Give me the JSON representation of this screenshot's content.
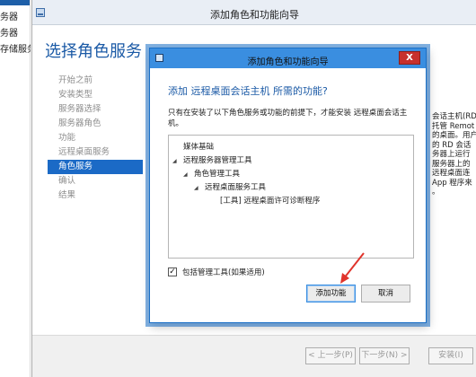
{
  "server_manager_sidebar": {
    "items": [
      "务器",
      "务器",
      "存储服务"
    ]
  },
  "outer_wizard": {
    "title": "添加角色和功能向导",
    "page_title": "选择角色服务",
    "nav": [
      {
        "label": "开始之前",
        "state": "normal"
      },
      {
        "label": "安装类型",
        "state": "normal"
      },
      {
        "label": "服务器选择",
        "state": "normal"
      },
      {
        "label": "服务器角色",
        "state": "normal"
      },
      {
        "label": "功能",
        "state": "normal"
      },
      {
        "label": "远程桌面服务",
        "state": "normal"
      },
      {
        "label": "角色服务",
        "state": "active"
      },
      {
        "label": "确认",
        "state": "normal"
      },
      {
        "label": "结果",
        "state": "normal"
      }
    ],
    "right_description_lines": [
      "会话主机(RD",
      "托管 Remot",
      "的桌面。用户",
      "的 RD 会话",
      "务器上运行",
      "服务器上的",
      "远程桌面连",
      "App 程序来",
      "。"
    ],
    "footer": {
      "prev_label": "< 上一步(P)",
      "next_label": "下一步(N) >",
      "install_label": "安装(I)"
    }
  },
  "dialog": {
    "title": "添加角色和功能向导",
    "close_label": "X",
    "heading": "添加 远程桌面会话主机 所需的功能?",
    "description": "只有在安装了以下角色服务或功能的前提下，才能安装 远程桌面会话主机。",
    "tree": [
      {
        "label": "媒体基础",
        "level": 0,
        "expander": false
      },
      {
        "label": "远程服务器管理工具",
        "level": 0,
        "expander": true
      },
      {
        "label": "角色管理工具",
        "level": 1,
        "expander": true
      },
      {
        "label": "远程桌面服务工具",
        "level": 2,
        "expander": true
      },
      {
        "label": "[工具] 远程桌面许可诊断程序",
        "level": 3,
        "expander": false
      }
    ],
    "include_tools": {
      "label": "包括管理工具(如果适用)",
      "checked": true
    },
    "add_features_label": "添加功能",
    "cancel_label": "取消"
  },
  "colors": {
    "accent": "#1b6ac6",
    "title_bar": "#3a8ee0",
    "close": "#c7302d",
    "annotation_arrow": "#e0342c"
  }
}
